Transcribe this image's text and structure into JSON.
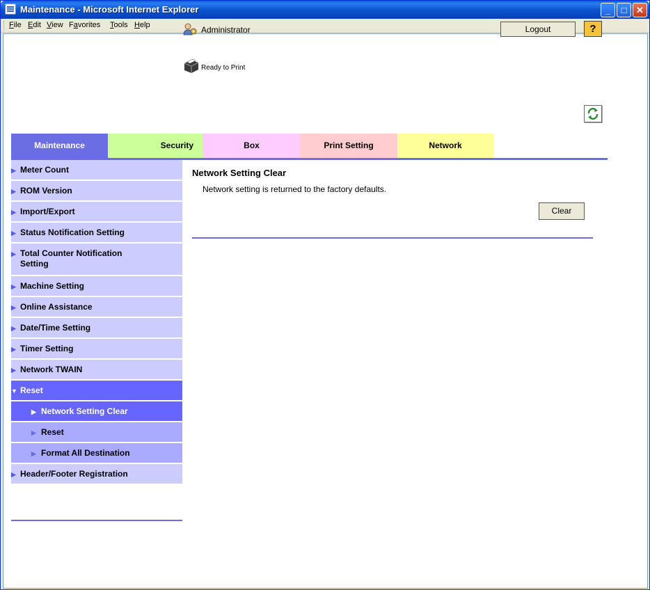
{
  "window": {
    "title": "Maintenance - Microsoft Internet Explorer",
    "minimize": "_",
    "maximize": "□",
    "close": "✕"
  },
  "menubar": {
    "items": [
      {
        "accel": "F",
        "rest": "ile"
      },
      {
        "accel": "E",
        "rest": "dit"
      },
      {
        "accel": "V",
        "rest": "iew"
      },
      {
        "pre": "F",
        "accel": "a",
        "rest": "vorites"
      },
      {
        "accel": "T",
        "rest": "ools"
      },
      {
        "accel": "H",
        "rest": "elp"
      }
    ]
  },
  "header": {
    "user": "Administrator",
    "logout": "Logout",
    "help": "?",
    "status": "Ready to Print"
  },
  "tabs": [
    "Maintenance",
    "Security",
    "Box",
    "Print Setting",
    "Network"
  ],
  "sidebar": {
    "items": [
      "Meter Count",
      "ROM Version",
      "Import/Export",
      "Status Notification Setting",
      "Total Counter Notification Setting",
      "Machine Setting",
      "Online Assistance",
      "Date/Time Setting",
      "Timer Setting",
      "Network TWAIN",
      "Reset"
    ],
    "reset_subitems": [
      "Network Setting Clear",
      "Reset",
      "Format All Destination"
    ],
    "last_item": "Header/Footer Registration"
  },
  "content": {
    "title": "Network Setting Clear",
    "description": "Network setting is returned to the factory defaults.",
    "clear_button": "Clear"
  },
  "colors": {
    "tab_maintenance": "#6b6ee3",
    "tab_security": "#ccff99",
    "tab_box": "#ffccff",
    "tab_print": "#ffccd0",
    "tab_network": "#ffff99",
    "sidebar_item": "#ccccff",
    "sidebar_active": "#6666ff",
    "sidebar_sub": "#aaaaff"
  }
}
